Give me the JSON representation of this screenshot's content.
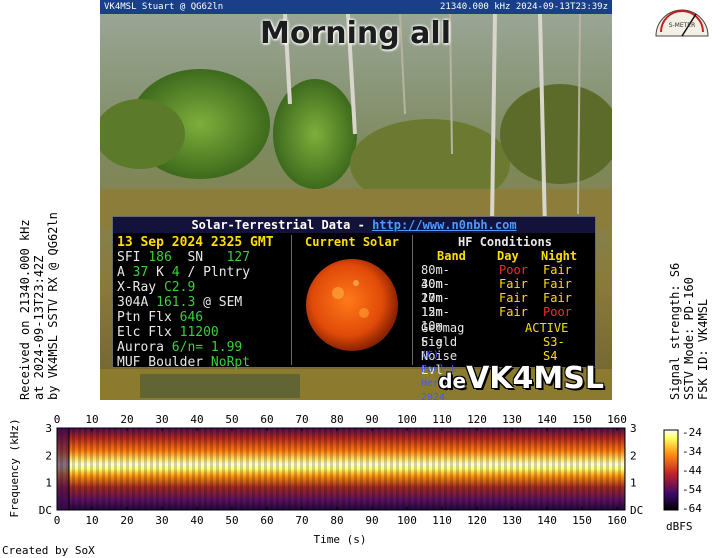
{
  "sstv": {
    "header_left": "VK4MSL Stuart @ QG62ln",
    "header_right": "21340.000 kHz 2024-09-13T23:39z",
    "greeting": "Morning all",
    "callsign_prefix": "de",
    "callsign": "VK4MSL"
  },
  "solar": {
    "title": "Solar-Terrestrial Data - ",
    "link": "http://www.n0nbh.com",
    "date_line": "13 Sep 2024 2325 GMT",
    "sfi_label": "SFI",
    "sfi_value": "186",
    "sn_label": "SN",
    "sn_value": "127",
    "a_label": "A",
    "a_value": "37",
    "k_label": "K",
    "k_value": "4",
    "k_extra": "/ Plntry",
    "xray_label": "X-Ray",
    "xray_value": "C2.9",
    "he304_label": "304A",
    "he304_value": "161.3",
    "he304_extra": "@ SEM",
    "ptn_label": "Ptn Flx",
    "ptn_value": "646",
    "elc_label": "Elc Flx",
    "elc_value": "11200",
    "aurora_label": "Aurora",
    "aurora_value": "6/n= 1.99",
    "muf_label": "MUF Boulder",
    "muf_value": "NoRpt",
    "current_solar_title": "Current Solar",
    "hf_title": "HF Conditions",
    "hf_headers": [
      "Band",
      "Day",
      "Night"
    ],
    "hf_rows": [
      {
        "band": "80m-40m",
        "day": "Poor",
        "night": "Fair"
      },
      {
        "band": "30m-20m",
        "day": "Fair",
        "night": "Fair"
      },
      {
        "band": "17m-15m",
        "day": "Fair",
        "night": "Fair"
      },
      {
        "band": "12m-10m",
        "day": "Fair",
        "night": "Poor"
      }
    ],
    "geomag_label": "Geomag Field",
    "geomag_value": "ACTIVE",
    "signoise_label": "Sig Noise Lvl",
    "signoise_value": "S3-S4",
    "copyright": "(C) Paul L Herrman 2024"
  },
  "side_left": [
    "Received on  21340.000 kHz",
    "at 2024-09-13T23:42Z",
    "by VK4MSL SSTV RX @ QG62ln"
  ],
  "side_right": [
    "Signal strength: S6",
    "SSTV Mode: PD-160",
    "FSK ID: VK4MSL"
  ],
  "dial": {
    "label": "S-METER"
  },
  "spectrogram": {
    "x_ticks": [
      "0",
      "10",
      "20",
      "30",
      "40",
      "50",
      "60",
      "70",
      "80",
      "90",
      "100",
      "110",
      "120",
      "130",
      "140",
      "150",
      "160"
    ],
    "y_ticks_left": [
      "DC",
      "1",
      "2",
      "3"
    ],
    "y_ticks_right": [
      "DC",
      "1",
      "2",
      "3"
    ],
    "y_label": "Frequency (kHz)",
    "x_label": "Time (s)",
    "colorbar_ticks": [
      "-24",
      "-34",
      "-44",
      "-54",
      "-64"
    ],
    "colorbar_unit": "dBFS",
    "credit": "Created by SoX"
  }
}
